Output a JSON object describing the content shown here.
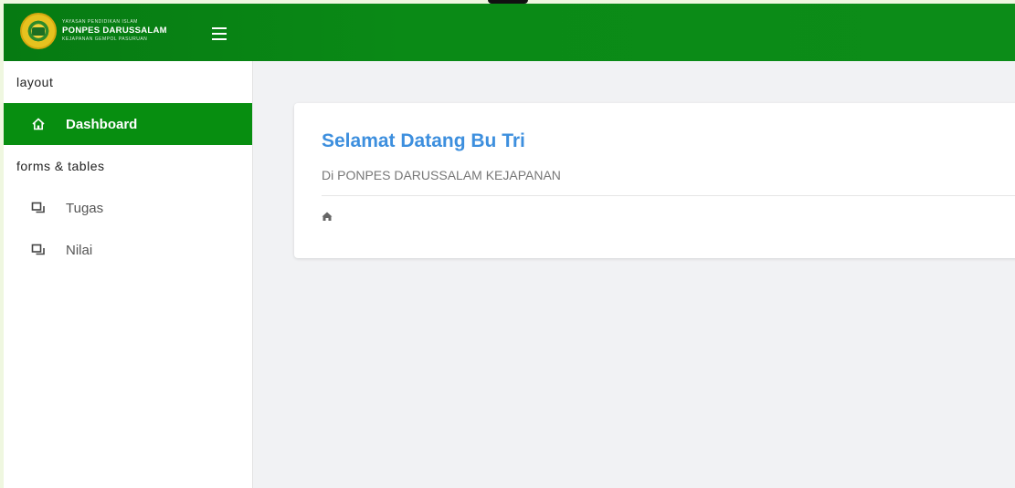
{
  "brand": {
    "org_small_top": "YAYASAN PENDIDIKAN ISLAM",
    "name": "PONPES DARUSSALAM",
    "org_small_bottom": "KEJAPANAN GEMPOL PASURUAN"
  },
  "sidebar": {
    "section_layout": "layout",
    "dashboard": {
      "label": "Dashboard",
      "icon": "home-icon"
    },
    "section_forms": "forms & tables",
    "items": [
      {
        "label": "Tugas",
        "icon": "copy-icon"
      },
      {
        "label": "Nilai",
        "icon": "copy-icon"
      }
    ]
  },
  "card": {
    "title": "Selamat Datang Bu Tri",
    "subtitle": "Di PONPES DARUSSALAM KEJAPANAN",
    "breadcrumb_icon": "home-icon"
  },
  "colors": {
    "topbar": "#0a8a16",
    "active_item": "#078e10",
    "title": "#3d8fde"
  }
}
